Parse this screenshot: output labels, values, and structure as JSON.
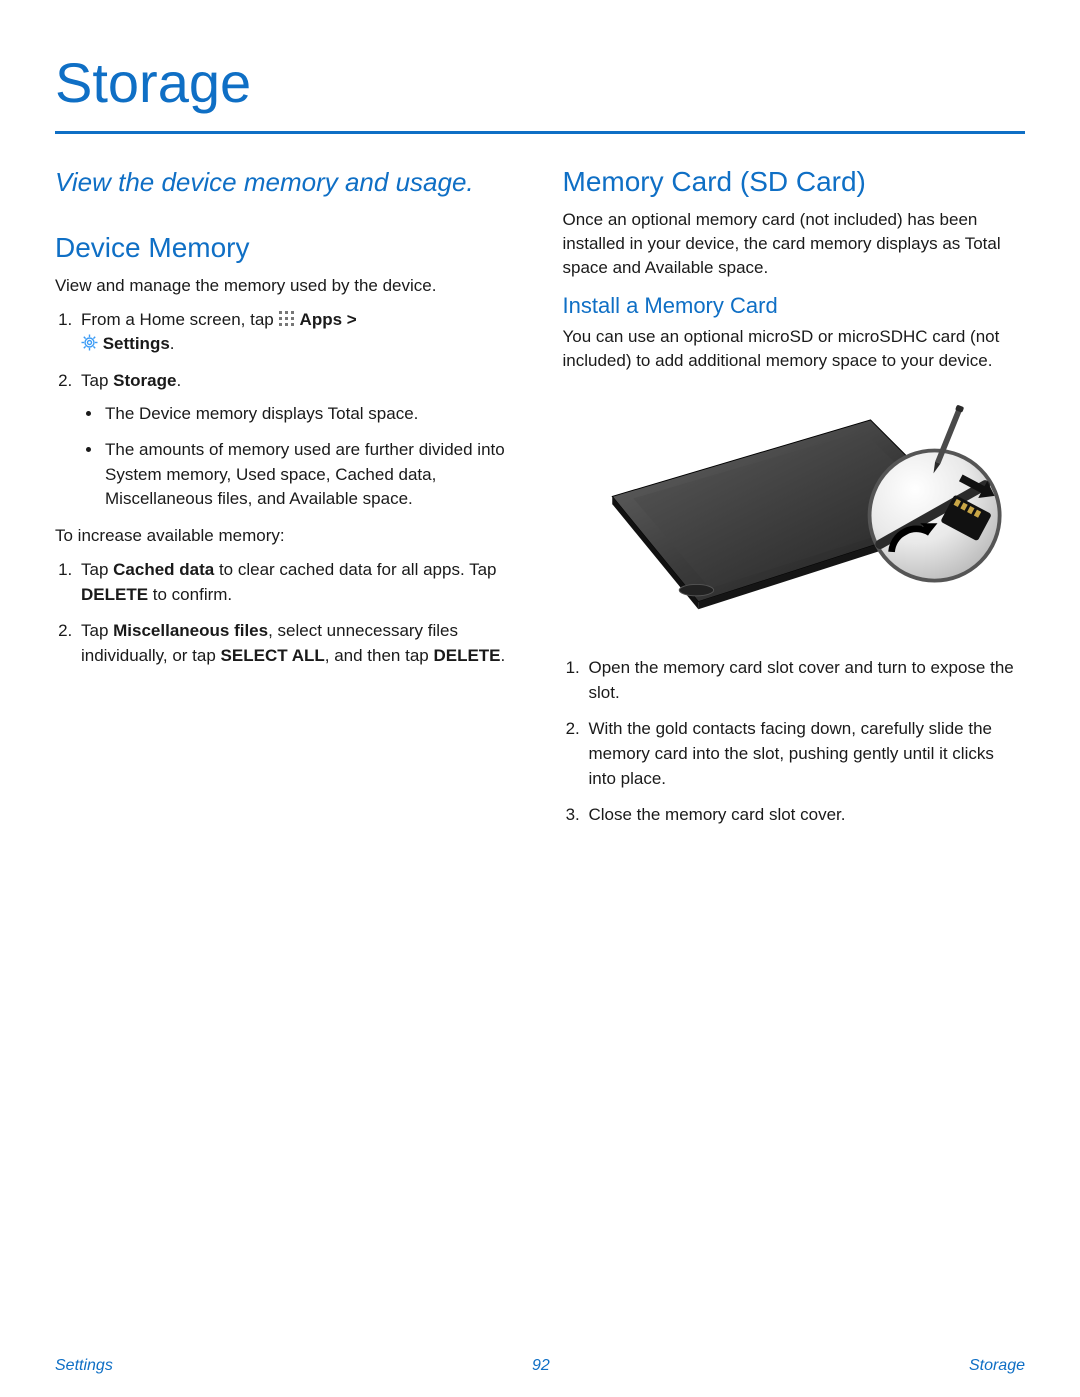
{
  "title": "Storage",
  "left": {
    "intro": "View the device memory and usage.",
    "h2": "Device Memory",
    "p1": "View and manage the memory used by the device.",
    "step1_a": "From a Home screen, tap ",
    "step1_b": " Apps > ",
    "step1_c": " Settings",
    "step1_d": ".",
    "step2_a": "Tap ",
    "step2_b": "Storage",
    "step2_c": ".",
    "bullet1": "The Device memory displays Total space.",
    "bullet2": "The amounts of memory used are further divided into System memory, Used space, Cached data, Miscellaneous files, and Available space.",
    "p2": "To increase available memory:",
    "inc1_a": "Tap ",
    "inc1_b": "Cached data",
    "inc1_c": " to clear cached data for all apps. Tap ",
    "inc1_d": "DELETE",
    "inc1_e": " to confirm.",
    "inc2_a": "Tap ",
    "inc2_b": "Miscellaneous files",
    "inc2_c": ", select unnecessary files individually, or tap ",
    "inc2_d": "SELECT ALL",
    "inc2_e": ", and then tap ",
    "inc2_f": "DELETE",
    "inc2_g": "."
  },
  "right": {
    "h2": "Memory Card (SD Card)",
    "p1": "Once an optional memory card (not included) has been installed in your device, the card memory displays as Total space and Available space.",
    "h3": "Install a Memory Card",
    "p2": "You can use an optional microSD or microSDHC card (not included) to add additional memory space to your device.",
    "inst1": "Open the memory card slot cover and turn to expose the slot.",
    "inst2": "With the gold contacts facing down, carefully slide the memory card into the slot, pushing gently until it clicks into place.",
    "inst3": "Close the memory card slot cover."
  },
  "footer": {
    "left": "Settings",
    "center": "92",
    "right": "Storage"
  }
}
